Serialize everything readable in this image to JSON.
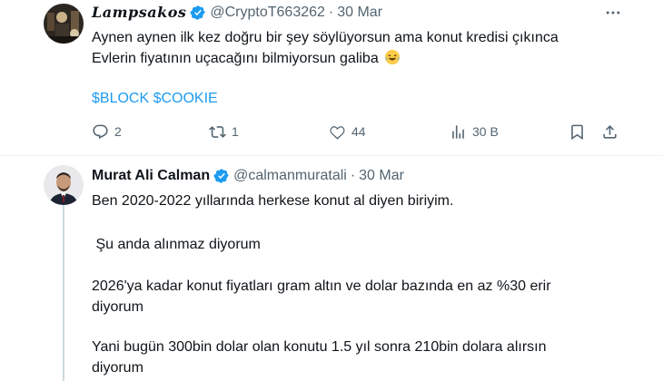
{
  "tweets": [
    {
      "author_name": "Lampsakos",
      "handle": "@CryptoT663262",
      "separator": "·",
      "date": "30 Mar",
      "lines": [
        "Aynen aynen ilk kez doğru bir şey söylüyorsun ama konut kredisi çıkınca",
        "Evlerin fiyatının uçacağını bilmiyorsun galiba"
      ],
      "cashtags": "$BLOCK $COOKIE",
      "stats": {
        "replies": "2",
        "reposts": "1",
        "likes": "44",
        "views": "30 B"
      }
    },
    {
      "author_name": "Murat Ali Calman",
      "handle": "@calmanmuratali",
      "separator": "·",
      "date": "30 Mar",
      "paragraphs": [
        "Ben 2020-2022 yıllarında herkese konut al diyen biriyim.",
        " Şu anda alınmaz diyorum",
        "2026'ya kadar konut fiyatları gram altın ve dolar bazında en az %30 erir",
        "diyorum",
        "Yani bugün 300bin dolar olan konutu 1.5 yıl sonra 210bin dolara alırsın",
        "diyorum"
      ]
    }
  ],
  "icons": {
    "verified": "verified-badge-icon",
    "more": "more-icon",
    "reply": "reply-icon",
    "repost": "repost-icon",
    "like": "like-icon",
    "views": "views-icon",
    "bookmark": "bookmark-icon",
    "share": "share-icon",
    "emoji": "laughing-tears-emoji"
  },
  "colors": {
    "accent": "#1d9bf0",
    "text": "#0f1419",
    "muted": "#536471",
    "divider": "#eff3f4"
  }
}
